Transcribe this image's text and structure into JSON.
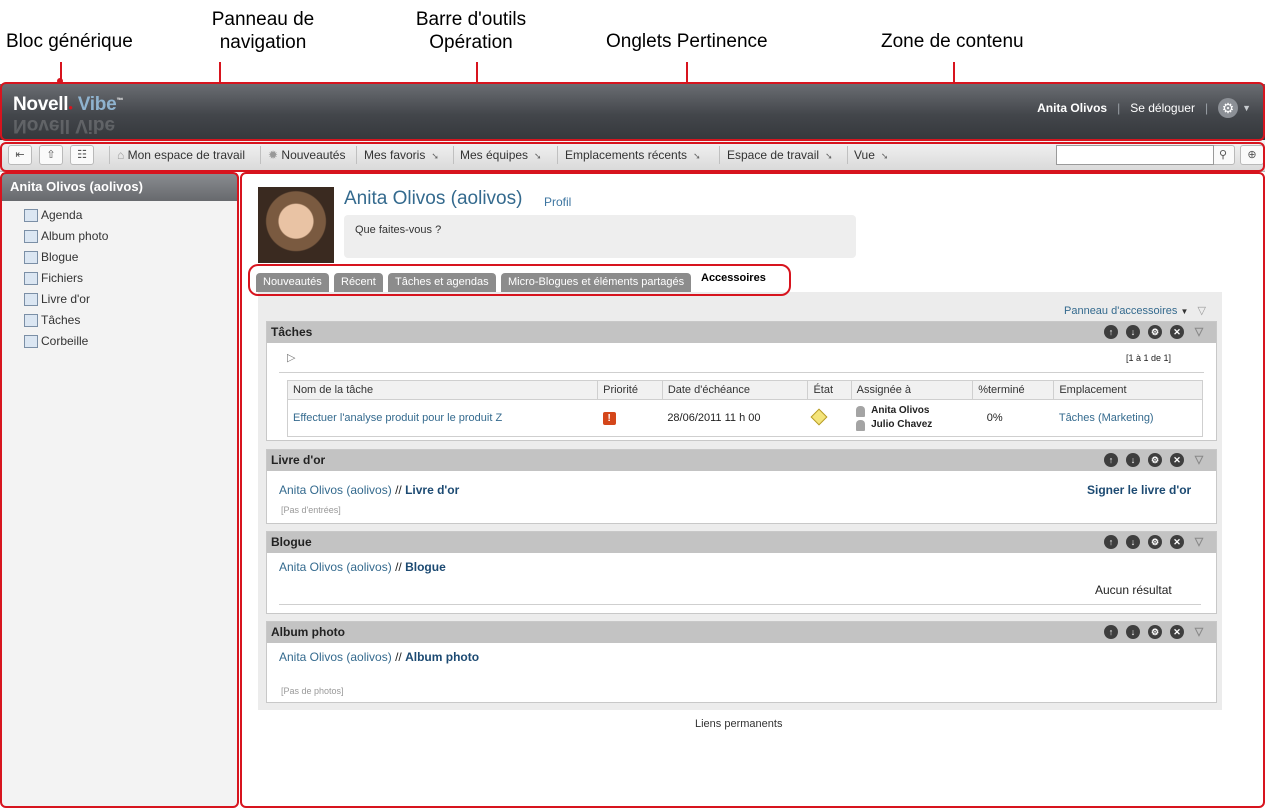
{
  "callouts": {
    "generic_block": "Bloc générique",
    "nav_panel_1": "Panneau de",
    "nav_panel_2": "navigation",
    "toolbar_1": "Barre d'outils",
    "toolbar_2": "Opération",
    "tabs": "Onglets Pertinence",
    "content": "Zone de contenu"
  },
  "masthead": {
    "logo_novell": "Novell",
    "logo_vibe": "Vibe",
    "user": "Anita Olivos",
    "logout": "Se déloguer",
    "sep": "|",
    "gear_icon": "gear-icon"
  },
  "toolbar": {
    "items": [
      "Mon espace de travail",
      "Nouveautés",
      "Mes favoris",
      "Mes équipes",
      "Emplacements récents",
      "Espace de travail",
      "Vue"
    ],
    "search_placeholder": ""
  },
  "sidebar": {
    "title": "Anita Olivos (aolivos)",
    "items": [
      "Agenda",
      "Album photo",
      "Blogue",
      "Fichiers",
      "Livre d'or",
      "Tâches",
      "Corbeille"
    ]
  },
  "profile": {
    "name": "Anita Olivos (aolivos)",
    "profile_link": "Profil",
    "status_prompt": "Que faites-vous ?"
  },
  "tabs": [
    "Nouveautés",
    "Récent",
    "Tâches et agendas",
    "Micro-Blogues et éléments partagés",
    "Accessoires"
  ],
  "accessory_panel": "Panneau d'accessoires",
  "tasks": {
    "title": "Tâches",
    "pager": "[1 à 1 de 1]",
    "columns": [
      "Nom de la tâche",
      "Priorité",
      "Date d'échéance",
      "État",
      "Assignée à",
      "%terminé",
      "Emplacement"
    ],
    "rows": [
      {
        "name": "Effectuer l'analyse produit pour le produit Z",
        "priority": "!",
        "due": "28/06/2011 11 h 00",
        "assignees": [
          "Anita Olivos",
          "Julio Chavez"
        ],
        "done": "0%",
        "location": "Tâches (Marketing)"
      }
    ]
  },
  "guestbook": {
    "title": "Livre d'or",
    "owner": "Anita Olivos (aolivos)",
    "path_sep": "//",
    "target": "Livre d'or",
    "sign": "Signer le livre d'or",
    "empty": "[Pas d'entrées]"
  },
  "blog": {
    "title": "Blogue",
    "owner": "Anita Olivos (aolivos)",
    "path_sep": "//",
    "target": "Blogue",
    "no_result": "Aucun résultat"
  },
  "album": {
    "title": "Album photo",
    "owner": "Anita Olivos (aolivos)",
    "path_sep": "//",
    "target": "Album photo",
    "empty": "[Pas de photos]"
  },
  "footer": "Liens permanents",
  "colors": {
    "accent_red": "#d7141e",
    "link": "#346a8e"
  }
}
